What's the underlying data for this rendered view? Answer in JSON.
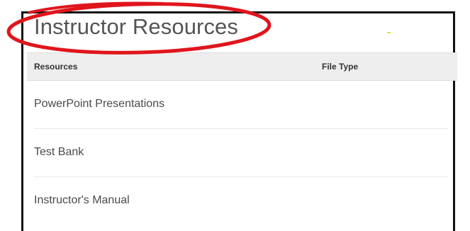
{
  "page": {
    "title": "Instructor Resources"
  },
  "table": {
    "headers": {
      "resources": "Resources",
      "file_type": "File Type"
    },
    "rows": [
      {
        "label": "PowerPoint Presentations",
        "file_type": ""
      },
      {
        "label": "Test Bank",
        "file_type": ""
      },
      {
        "label": "Instructor's Manual",
        "file_type": ""
      }
    ]
  },
  "colors": {
    "annotation": "#e0151c",
    "frame_border": "#111111",
    "header_bg": "#eeeeee",
    "title_text": "#555555"
  }
}
